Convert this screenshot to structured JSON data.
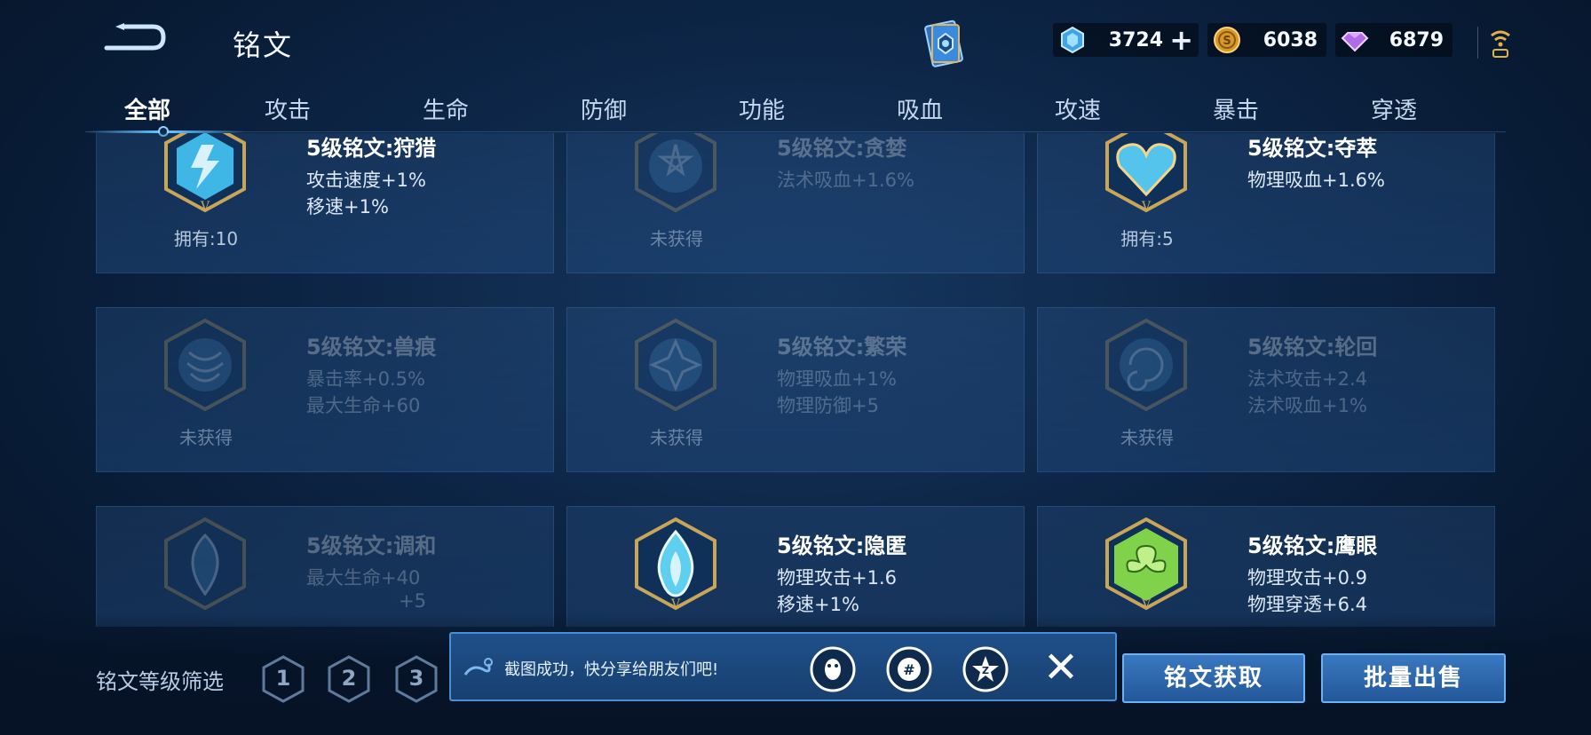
{
  "header": {
    "title": "铭文",
    "back_icon": "back-arrow-icon",
    "card_icon": "rune-card-icon"
  },
  "currencies": [
    {
      "icon": "crystal-icon",
      "value": "3724",
      "has_plus": true,
      "plus": "+"
    },
    {
      "icon": "gold-coin-icon",
      "value": "6038"
    },
    {
      "icon": "gem-icon",
      "value": "6879"
    }
  ],
  "tabs": [
    {
      "label": "全部",
      "active": true
    },
    {
      "label": "攻击"
    },
    {
      "label": "生命"
    },
    {
      "label": "防御"
    },
    {
      "label": "功能"
    },
    {
      "label": "吸血"
    },
    {
      "label": "攻速"
    },
    {
      "label": "暴击"
    },
    {
      "label": "穿透"
    }
  ],
  "runes": [
    {
      "name": "5级铭文:狩猎",
      "stats": [
        "攻击速度+1%",
        "移速+1%"
      ],
      "status": "拥有:10",
      "owned": true,
      "emblem": "lightning-emblem-icon",
      "color": "#3fb7e6"
    },
    {
      "name": "5级铭文:贪婪",
      "stats": [
        "法术吸血+1.6%"
      ],
      "status": "未获得",
      "owned": false,
      "emblem": "star-emblem-icon",
      "color": "#3a7bb0"
    },
    {
      "name": "5级铭文:夺萃",
      "stats": [
        "物理吸血+1.6%"
      ],
      "status": "拥有:5",
      "owned": true,
      "emblem": "heart-knot-emblem-icon",
      "color": "#55c4ec"
    },
    {
      "name": "5级铭文:兽痕",
      "stats": [
        "暴击率+0.5%",
        "最大生命+60"
      ],
      "status": "未获得",
      "owned": false,
      "emblem": "claw-emblem-icon",
      "color": "#3a7bb0"
    },
    {
      "name": "5级铭文:繁荣",
      "stats": [
        "物理吸血+1%",
        "物理防御+5"
      ],
      "status": "未获得",
      "owned": false,
      "emblem": "flower-emblem-icon",
      "color": "#3a7bb0"
    },
    {
      "name": "5级铭文:轮回",
      "stats": [
        "法术攻击+2.4",
        "法术吸血+1%"
      ],
      "status": "未获得",
      "owned": false,
      "emblem": "swirl-emblem-icon",
      "color": "#3a7bb0"
    },
    {
      "name": "5级铭文:调和",
      "stats": [
        "最大生命+40",
        "+5"
      ],
      "status": "",
      "owned": false,
      "emblem": "leaf-emblem-icon",
      "color": "#3a7bb0"
    },
    {
      "name": "5级铭文:隐匿",
      "stats": [
        "物理攻击+1.6",
        "移速+1%"
      ],
      "status": "",
      "owned": true,
      "emblem": "flame-emblem-icon",
      "color": "#5fcff0"
    },
    {
      "name": "5级铭文:鹰眼",
      "stats": [
        "物理攻击+0.9",
        "物理穿透+6.4"
      ],
      "status": "",
      "owned": true,
      "emblem": "clover-emblem-icon",
      "color": "#7fd24a"
    }
  ],
  "filter": {
    "label": "铭文等级筛选",
    "levels": [
      "1",
      "2",
      "3"
    ]
  },
  "share": {
    "text": "截图成功，快分享给朋友们吧!",
    "icons": [
      "qq-icon",
      "wechat-icon",
      "qzone-icon"
    ],
    "close": "✕"
  },
  "buttons": {
    "obtain": "铭文获取",
    "sell": "批量出售"
  }
}
